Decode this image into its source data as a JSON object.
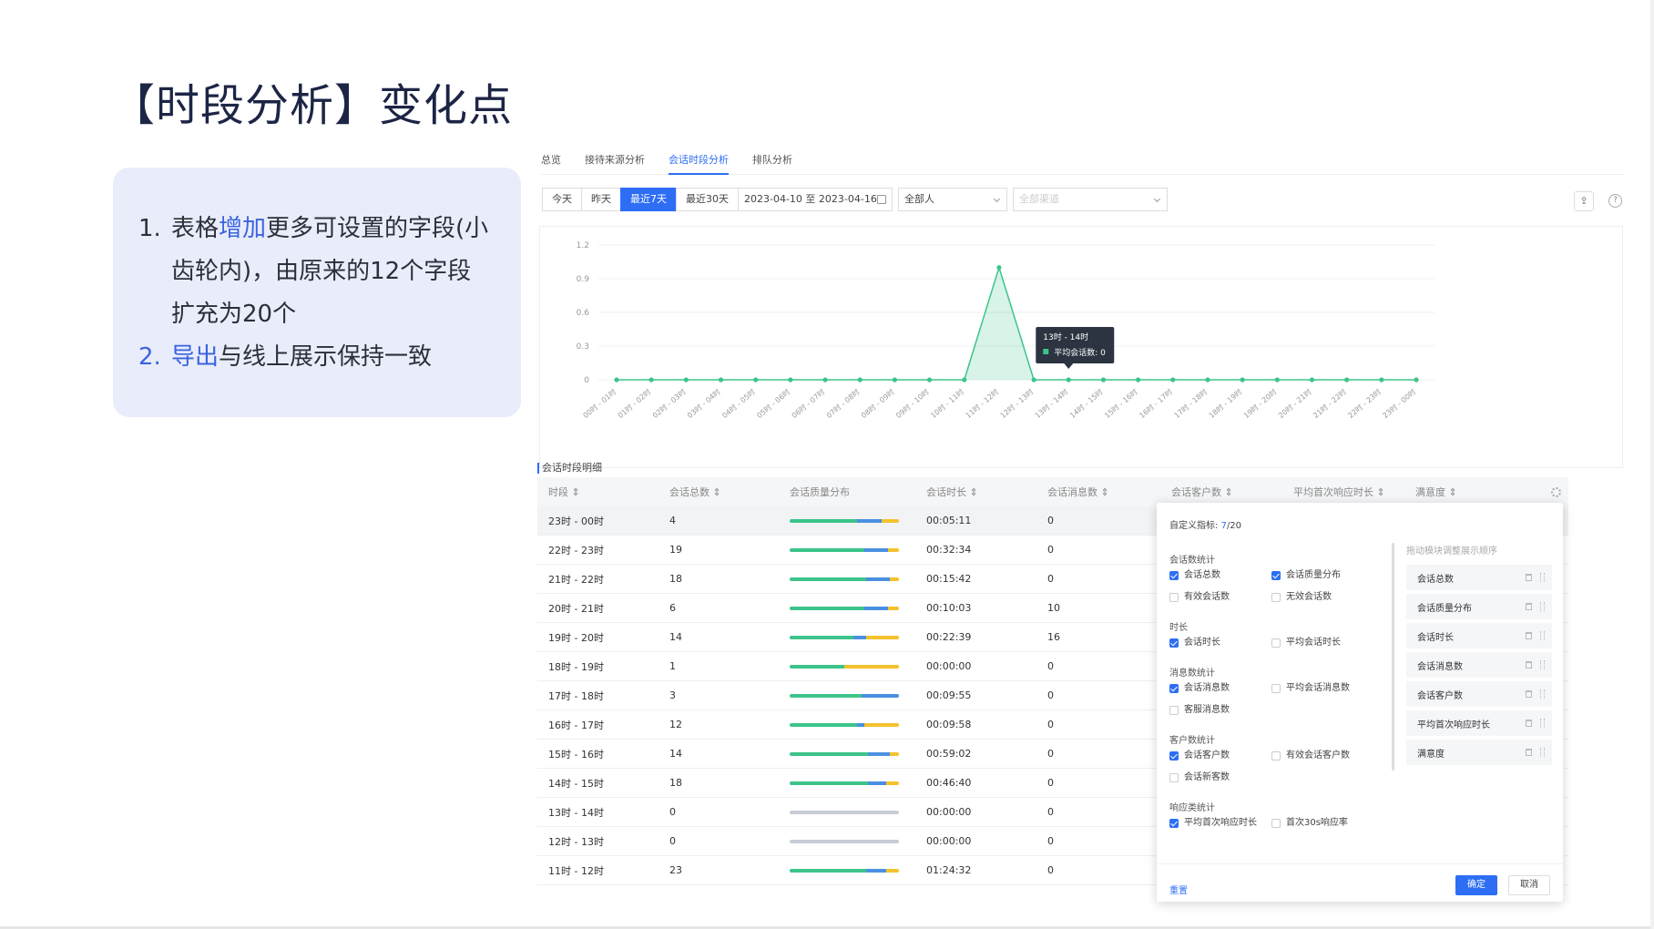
{
  "slide": {
    "title": "【时段分析】变化点",
    "notes": [
      {
        "num": "1.",
        "pre": "表格",
        "hl": "增加",
        "post": "更多可设置的字段(小齿轮内)，由原来的12个字段扩充为20个"
      },
      {
        "num": "2.",
        "pre": "",
        "hl": "导出",
        "post": "与线上展示保持一致"
      }
    ]
  },
  "app": {
    "tabs": [
      "总览",
      "接待来源分析",
      "会话时段分析",
      "排队分析"
    ],
    "active_tab": 2,
    "filters": {
      "quick": [
        "今天",
        "昨天",
        "最近7天",
        "最近30天"
      ],
      "active_quick": 2,
      "date_range": "2023-04-10 至 2023-04-16",
      "person_select": "全部人",
      "channel_select": "全部渠道"
    },
    "icons": {
      "export": "export-icon",
      "help": "help-icon"
    },
    "colors": {
      "accent": "#2d6ef5",
      "series": "#3cc48a",
      "bar_blue": "#4a90e2",
      "bar_yellow": "#f5c22d",
      "bar_gray": "#c8ccd6"
    }
  },
  "chart_data": {
    "type": "area",
    "x": [
      "00时 - 01时",
      "01时 - 02时",
      "02时 - 03时",
      "03时 - 04时",
      "04时 - 05时",
      "05时 - 06时",
      "06时 - 07时",
      "07时 - 08时",
      "08时 - 09时",
      "09时 - 10时",
      "10时 - 11时",
      "11时 - 12时",
      "12时 - 13时",
      "13时 - 14时",
      "14时 - 15时",
      "15时 - 16时",
      "16时 - 17时",
      "17时 - 18时",
      "18时 - 19时",
      "19时 - 20时",
      "20时 - 21时",
      "21时 - 22时",
      "22时 - 23时",
      "23时 - 00时"
    ],
    "series": [
      {
        "values": [
          0,
          0,
          0,
          0,
          0,
          0,
          0,
          0,
          0,
          0,
          0,
          1,
          0,
          0,
          0,
          0,
          0,
          0,
          0,
          0,
          0,
          0,
          0,
          0
        ]
      }
    ],
    "yticks": [
      "1.2",
      "0.9",
      "0.6",
      "0.3",
      "0"
    ],
    "ylim": [
      0,
      1.2
    ],
    "grid": true,
    "tooltip": {
      "title": "13时 - 14时",
      "label": "平均会话数: 0",
      "index": 13
    }
  },
  "table": {
    "section_label": "会话时段明细",
    "headers": [
      "时段 ⇕",
      "会话总数 ⇕",
      "会话质量分布",
      "会话时长 ⇕",
      "会话消息数 ⇕",
      "会话客户数 ⇕",
      "平均首次响应时长 ⇕",
      "满意度 ⇕"
    ],
    "rows": [
      {
        "period": "23时 - 00时",
        "total": "4",
        "q": [
          0.62,
          0.22,
          0.16
        ],
        "dur": "00:05:11",
        "msgs": "0"
      },
      {
        "period": "22时 - 23时",
        "total": "19",
        "q": [
          0.68,
          0.22,
          0.1
        ],
        "dur": "00:32:34",
        "msgs": "0"
      },
      {
        "period": "21时 - 22时",
        "total": "18",
        "q": [
          0.7,
          0.22,
          0.08
        ],
        "dur": "00:15:42",
        "msgs": "0"
      },
      {
        "period": "20时 - 21时",
        "total": "6",
        "q": [
          0.68,
          0.22,
          0.1
        ],
        "dur": "00:10:03",
        "msgs": "10"
      },
      {
        "period": "19时 - 20时",
        "total": "14",
        "q": [
          0.58,
          0.12,
          0.3
        ],
        "dur": "00:22:39",
        "msgs": "16"
      },
      {
        "period": "18时 - 19时",
        "total": "1",
        "q": [
          0.5,
          0.0,
          0.5
        ],
        "dur": "00:00:00",
        "msgs": "0"
      },
      {
        "period": "17时 - 18时",
        "total": "3",
        "q": [
          0.66,
          0.34,
          0.0
        ],
        "dur": "00:09:55",
        "msgs": "0"
      },
      {
        "period": "16时 - 17时",
        "total": "12",
        "q": [
          0.62,
          0.06,
          0.32
        ],
        "dur": "00:09:58",
        "msgs": "0"
      },
      {
        "period": "15时 - 16时",
        "total": "14",
        "q": [
          0.72,
          0.2,
          0.08
        ],
        "dur": "00:59:02",
        "msgs": "0"
      },
      {
        "period": "14时 - 15时",
        "total": "18",
        "q": [
          0.72,
          0.16,
          0.12
        ],
        "dur": "00:46:40",
        "msgs": "0"
      },
      {
        "period": "13时 - 14时",
        "total": "0",
        "q": [
          0,
          0,
          0
        ],
        "dur": "00:00:00",
        "msgs": "0"
      },
      {
        "period": "12时 - 13时",
        "total": "0",
        "q": [
          0,
          0,
          0
        ],
        "dur": "00:00:00",
        "msgs": "0"
      },
      {
        "period": "11时 - 12时",
        "total": "23",
        "q": [
          0.7,
          0.18,
          0.12
        ],
        "dur": "01:24:32",
        "msgs": "0"
      }
    ]
  },
  "panel": {
    "title": "自定义指标:",
    "count": "7",
    "total": "/20",
    "groups": [
      {
        "title": "会话数统计",
        "options": [
          {
            "label": "会话总数",
            "on": true
          },
          {
            "label": "会话质量分布",
            "on": true
          },
          {
            "label": "有效会话数",
            "on": false
          },
          {
            "label": "无效会话数",
            "on": false
          }
        ]
      },
      {
        "title": "时长",
        "options": [
          {
            "label": "会话时长",
            "on": true
          },
          {
            "label": "平均会话时长",
            "on": false
          }
        ]
      },
      {
        "title": "消息数统计",
        "options": [
          {
            "label": "会话消息数",
            "on": true
          },
          {
            "label": "平均会话消息数",
            "on": false
          },
          {
            "label": "客服消息数",
            "on": false
          }
        ]
      },
      {
        "title": "客户数统计",
        "options": [
          {
            "label": "会话客户数",
            "on": true
          },
          {
            "label": "有效会话客户数",
            "on": false
          },
          {
            "label": "会话新客数",
            "on": false
          }
        ]
      },
      {
        "title": "响应类统计",
        "options": [
          {
            "label": "平均首次响应时长",
            "on": true
          },
          {
            "label": "首次30s响应率",
            "on": false
          }
        ]
      }
    ],
    "drag_hint": "拖动模块调整展示顺序",
    "sorted": [
      "会话总数",
      "会话质量分布",
      "会话时长",
      "会话消息数",
      "会话客户数",
      "平均首次响应时长",
      "满意度"
    ],
    "reset": "重置",
    "ok": "确定",
    "cancel": "取消"
  }
}
